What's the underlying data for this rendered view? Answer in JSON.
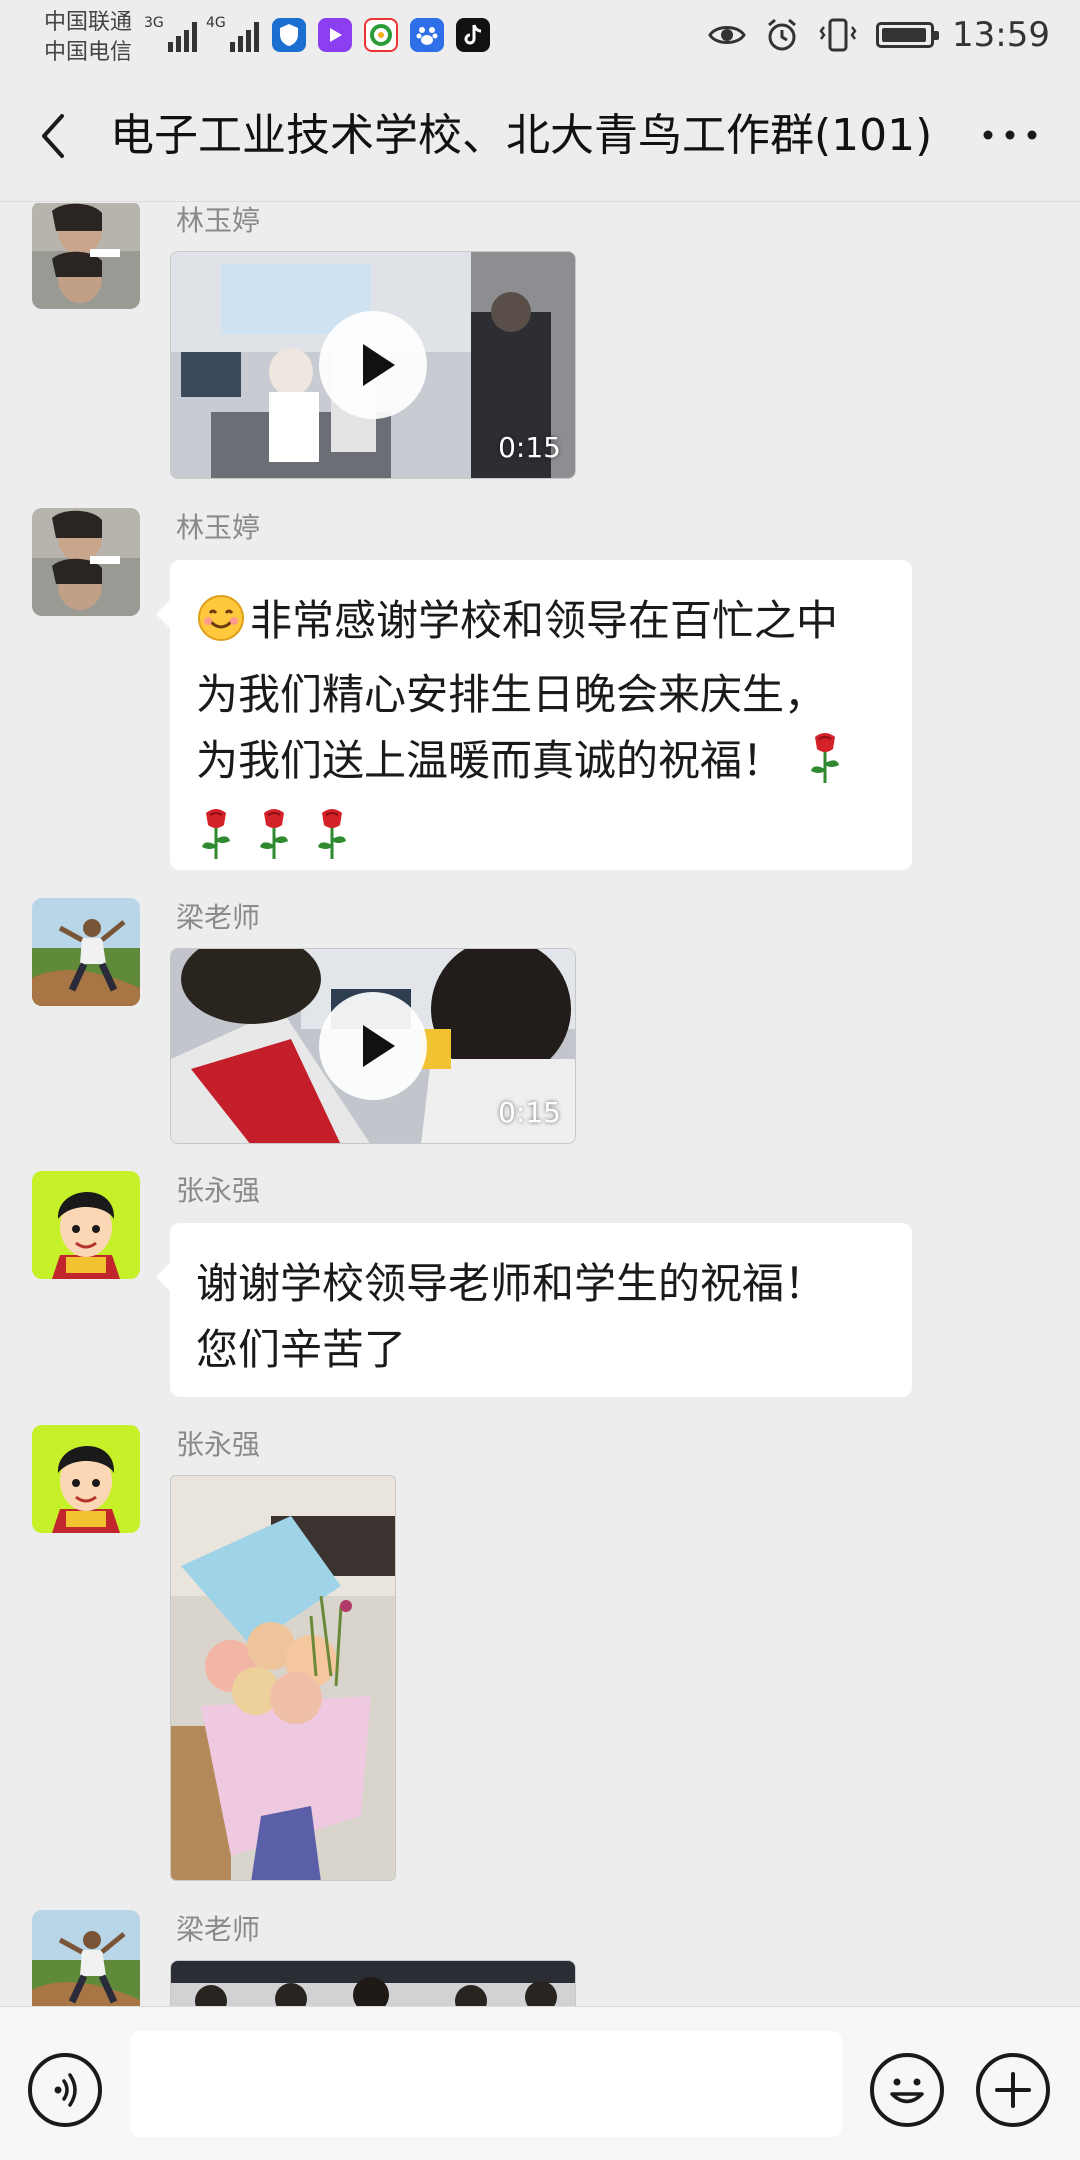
{
  "status_bar": {
    "carrier_1": "中国联通",
    "carrier_2": "中国电信",
    "sig1_tag": "3G",
    "sig2_tag": "4G",
    "time": "13:59",
    "battery_level": 0.95,
    "icons": [
      "signal-3g-icon",
      "signal-4g-icon",
      "shield-app-icon",
      "video-app-icon",
      "browser-app-icon",
      "baidu-app-icon",
      "tiktok-app-icon",
      "eye-icon",
      "alarm-icon",
      "vibrate-icon",
      "battery-icon"
    ]
  },
  "header": {
    "title": "电子工业技术学校、北大青鸟工作群(101)",
    "back_icon": "chevron-left-icon",
    "more_icon": "more-dots-icon"
  },
  "messages": [
    {
      "sender": "林玉婷",
      "type": "video",
      "duration": "0:15"
    },
    {
      "sender": "林玉婷",
      "type": "text",
      "line_1": "非常感谢学校和领导在百忙之中",
      "line_2": "为我们精心安排生日晚会来庆生，",
      "line_3": "为我们送上温暖而真诚的祝福！",
      "emoji_icons": [
        "smile-emoji-icon",
        "rose-emoji-icon"
      ]
    },
    {
      "sender": "梁老师",
      "type": "video",
      "duration": "0:15"
    },
    {
      "sender": "张永强",
      "type": "text",
      "line_1": "谢谢学校领导老师和学生的祝福！",
      "line_2": "您们辛苦了"
    },
    {
      "sender": "张永强",
      "type": "image"
    },
    {
      "sender": "梁老师",
      "type": "video"
    }
  ],
  "input_bar": {
    "voice_icon": "voice-icon",
    "emoji_icon": "emoji-icon",
    "plus_icon": "plus-icon",
    "placeholder": ""
  },
  "colors": {
    "background": "#ededed",
    "bubble": "#ffffff",
    "sender_text": "#8a8a8a"
  }
}
